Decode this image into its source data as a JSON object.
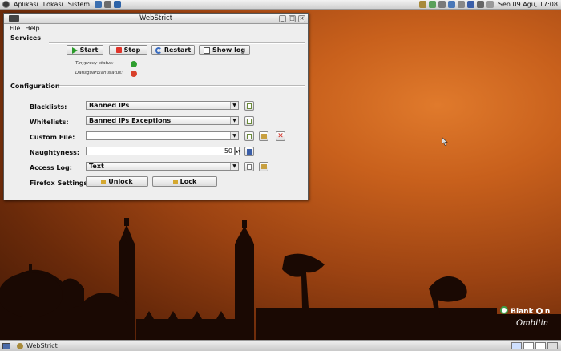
{
  "top_panel": {
    "menus": [
      "Aplikasi",
      "Lokasi",
      "Sistem"
    ],
    "clock": "Sen 09 Agu, 17:08"
  },
  "window": {
    "title": "WebStrict",
    "menu": [
      "File",
      "Help"
    ],
    "services": {
      "title": "Services",
      "buttons": {
        "start": "Start",
        "stop": "Stop",
        "restart": "Restart",
        "show_log": "Show log"
      },
      "status": [
        {
          "label": "Tinyproxy status:",
          "state": "running",
          "color": "#2e9e2e"
        },
        {
          "label": "Dansguardian status:",
          "state": "stopped",
          "color": "#d8402a"
        }
      ]
    },
    "configuration": {
      "title": "Configuration",
      "blacklists": {
        "label": "Blacklists:",
        "value": "Banned IPs"
      },
      "whitelists": {
        "label": "Whitelists:",
        "value": "Banned IPs Exceptions"
      },
      "custom_file": {
        "label": "Custom File:",
        "value": ""
      },
      "naughtyness": {
        "label": "Naughtyness:",
        "value": "50"
      },
      "access_log": {
        "label": "Access Log:",
        "value": "Text"
      },
      "firefox": {
        "label": "Firefox Settings:",
        "unlock": "Unlock",
        "lock": "Lock"
      }
    }
  },
  "taskbar": {
    "task": "WebStrict"
  },
  "branding": {
    "name": "Blank",
    "name_tail": "n",
    "sub": "Ombilin"
  },
  "colors": {
    "desktop": "#b8561a",
    "window_bg": "#eeeeee"
  }
}
